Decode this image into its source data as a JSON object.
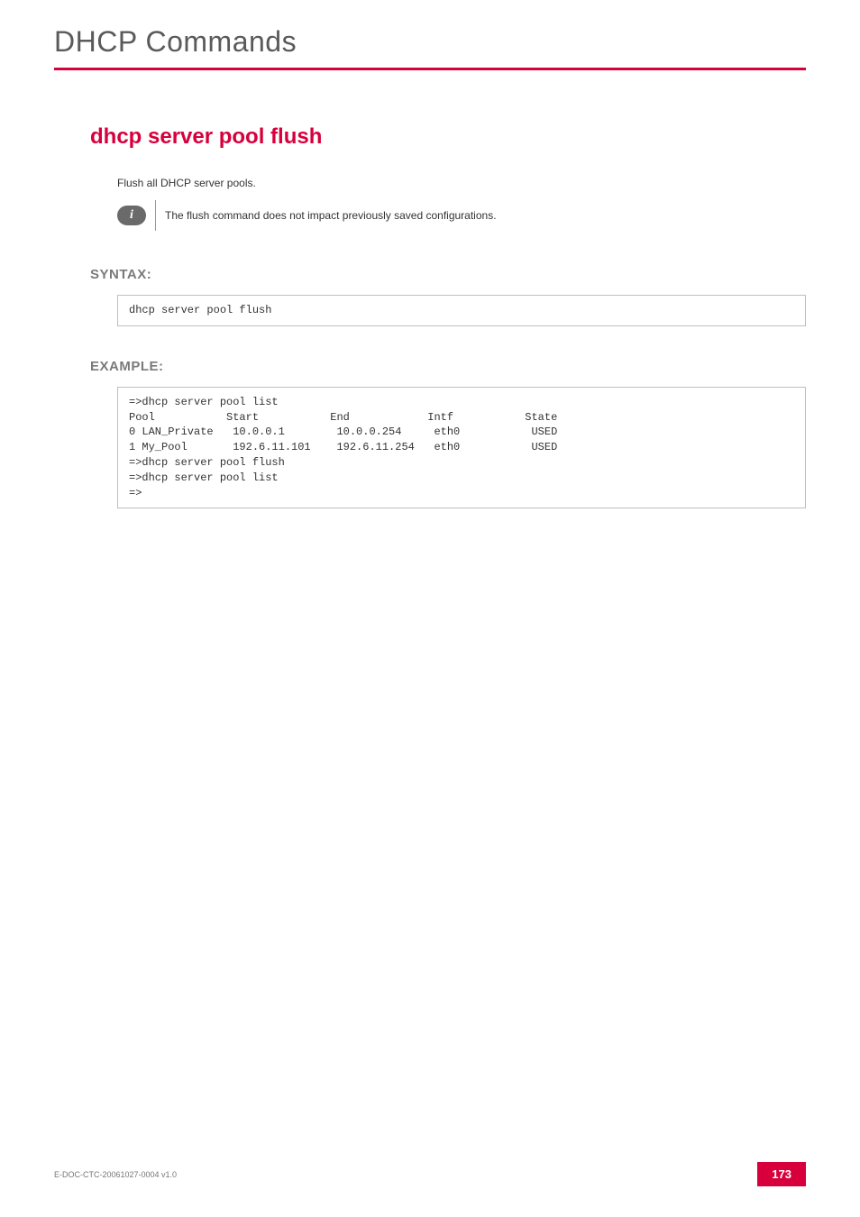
{
  "chapter": {
    "title": "DHCP Commands"
  },
  "section": {
    "title": "dhcp server pool flush"
  },
  "intro": {
    "text": "Flush all DHCP server pools."
  },
  "info": {
    "glyph": "i",
    "text": "The flush command does not impact previously saved configurations."
  },
  "syntax": {
    "label": "SYNTAX:",
    "code": "dhcp server pool flush"
  },
  "example": {
    "label": "EXAMPLE:",
    "code": "=>dhcp server pool list\nPool           Start           End            Intf           State\n0 LAN_Private   10.0.0.1        10.0.0.254     eth0           USED\n1 My_Pool       192.6.11.101    192.6.11.254   eth0           USED\n=>dhcp server pool flush\n=>dhcp server pool list\n=>"
  },
  "footer": {
    "doc_id": "E-DOC-CTC-20061027-0004 v1.0",
    "page_number": "173"
  }
}
